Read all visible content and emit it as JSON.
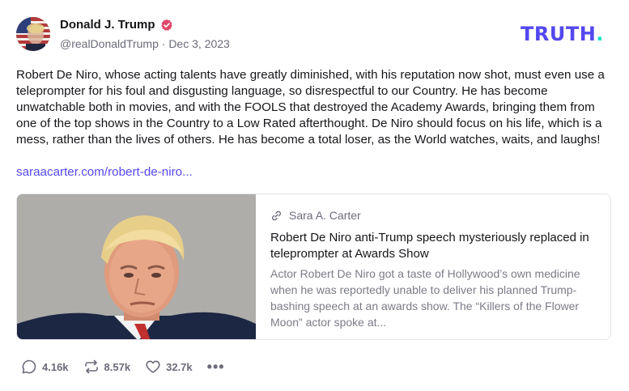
{
  "author": {
    "name": "Donald J. Trump",
    "handle": "@realDonaldTrump",
    "separator": "·",
    "date": "Dec 3, 2023",
    "verified_icon": "verified-badge-icon",
    "avatar_icon": "avatar"
  },
  "brand": {
    "logo_text": "TRUTH",
    "logo_dot": ".",
    "accent_color": "#5448ee",
    "dot_color": "#17e2c7"
  },
  "post": {
    "text": "Robert De Niro, whose acting talents have greatly diminished, with his reputation now shot, must even use a teleprompter for his foul and disgusting language, so disrespectful to our Country. He has become unwatchable both in movies, and with the FOOLS that destroyed the Academy Awards, bringing them from one of the top shows in the Country to a Low Rated afterthought. De Niro should focus on his life, which is a mess, rather than the lives of others. He has become a total loser, as the World watches, waits, and laughs!",
    "link_text": "saraacarter.com/robert-de-niro..."
  },
  "card": {
    "source_icon": "link-icon",
    "source": "Sara A. Carter",
    "title": "Robert De Niro anti-Trump speech mysteriously replaced in teleprompter at Awards Show",
    "description": "Actor Robert De Niro got a taste of Hollywood’s own medicine when he was reportedly unable to deliver his planned Trump-bashing speech at an awards show. The “Killers of the Flower Moon” actor spoke at..."
  },
  "actions": {
    "replies": "4.16k",
    "retruths": "8.57k",
    "likes": "32.7k",
    "more": "•••",
    "icons": [
      "reply-icon",
      "retruth-icon",
      "heart-icon",
      "more-icon"
    ]
  }
}
